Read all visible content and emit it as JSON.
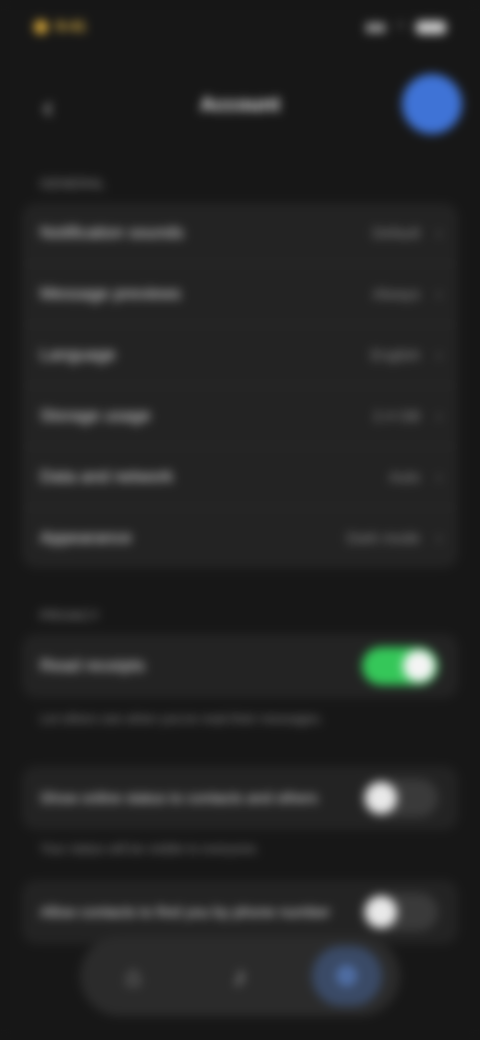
{
  "status_bar": {
    "time": "9:41",
    "signal": "signal-icon",
    "wifi": "wifi-icon",
    "battery": "battery-icon"
  },
  "nav": {
    "back_icon": "chevron-left-icon",
    "title": "Account",
    "avatar": "user-avatar"
  },
  "sections": {
    "general_label": "GENERAL",
    "general_rows": [
      {
        "label": "Notification sounds",
        "value": "Default"
      },
      {
        "label": "Message previews",
        "value": "Always"
      },
      {
        "label": "Language",
        "value": "English"
      },
      {
        "label": "Storage usage",
        "value": "2.4 GB"
      },
      {
        "label": "Data and network",
        "value": "Auto"
      },
      {
        "label": "Appearance",
        "value": "Dark mode"
      }
    ],
    "privacy_label": "PRIVACY",
    "privacy_toggle_label": "Read receipts",
    "privacy_toggle_state": true,
    "privacy_footnote": "Let others see when you've read their messages.",
    "option2_label": "Show online status to contacts and others",
    "option2_state": false,
    "option2_footnote": "Your status will be visible to everyone.",
    "option3_label": "Allow contacts to find you by phone number",
    "option3_state": false
  },
  "tabs": [
    {
      "name": "home-icon",
      "glyph": "⌂",
      "active": false
    },
    {
      "name": "bell-icon",
      "glyph": "🔔",
      "active": false
    },
    {
      "name": "settings-icon",
      "glyph": "⚙",
      "active": true
    }
  ],
  "colors": {
    "background": "#171717",
    "card": "#232323",
    "accent_green": "#35c759",
    "accent_blue": "#3f73d6"
  }
}
